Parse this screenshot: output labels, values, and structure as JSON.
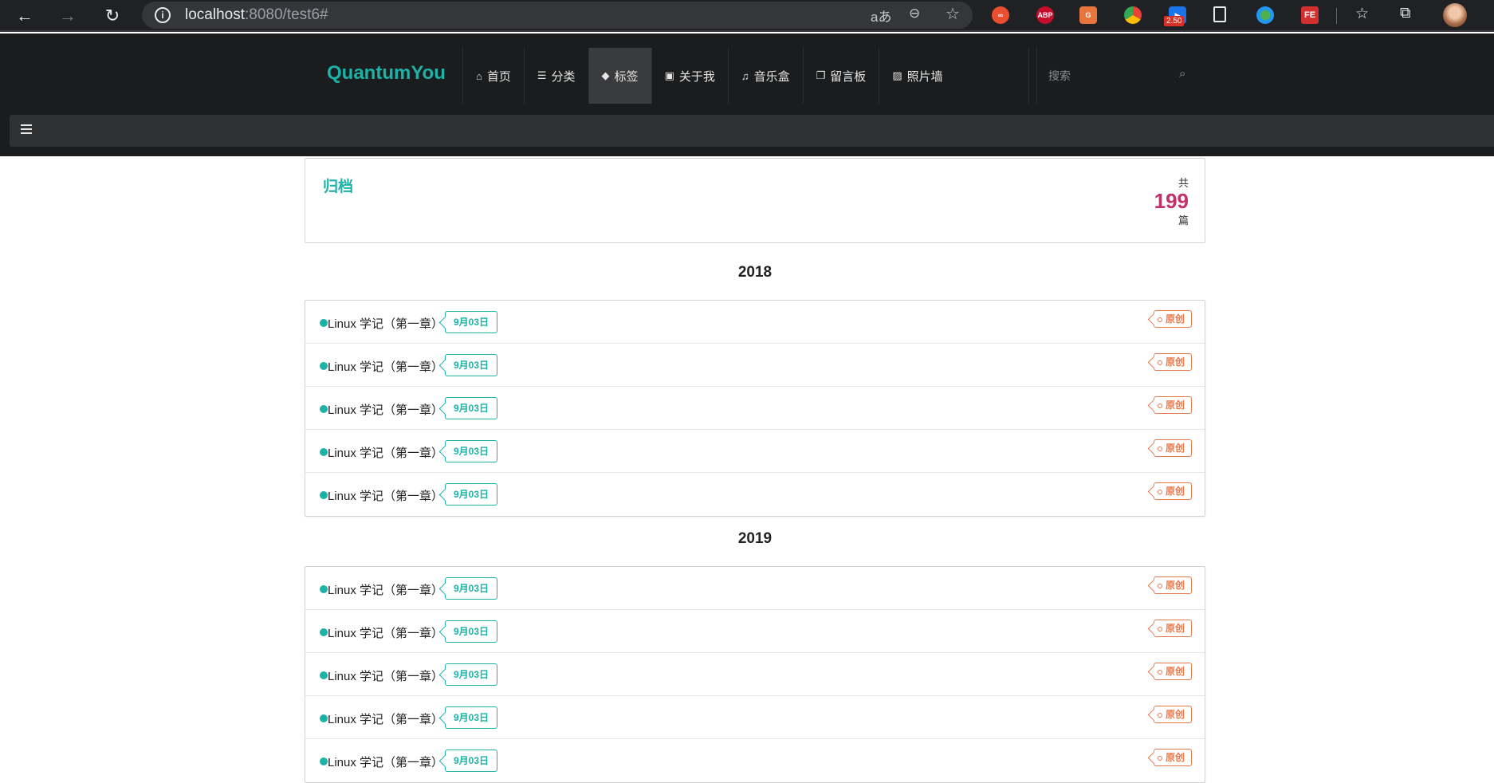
{
  "browser": {
    "url_host": "localhost",
    "url_rest": ":8080/test6#",
    "translate_icon": "aあ",
    "ext_abp": "ABP",
    "ext_go": "G",
    "ext_badge": "2.50",
    "ext_fe": "FE"
  },
  "site": {
    "brand": "QuantumYou",
    "menu": [
      {
        "icon": "⌂",
        "label": "首页"
      },
      {
        "icon": "☰",
        "label": "分类"
      },
      {
        "icon": "◆",
        "label": "标签"
      },
      {
        "icon": "▣",
        "label": "关于我"
      },
      {
        "icon": "♫",
        "label": "音乐盒"
      },
      {
        "icon": "❐",
        "label": "留言板"
      },
      {
        "icon": "▨",
        "label": "照片墙"
      }
    ],
    "search_placeholder": "搜索"
  },
  "archive": {
    "title": "归档",
    "count_pre": "共",
    "count": "199",
    "count_post": "篇"
  },
  "groups": [
    {
      "year": "2018",
      "items": [
        {
          "title": "Linux 学记（第一章）",
          "date": "9月03日",
          "tag": "原创"
        },
        {
          "title": "Linux 学记（第一章）",
          "date": "9月03日",
          "tag": "原创"
        },
        {
          "title": "Linux 学记（第一章）",
          "date": "9月03日",
          "tag": "原创"
        },
        {
          "title": "Linux 学记（第一章）",
          "date": "9月03日",
          "tag": "原创"
        },
        {
          "title": "Linux 学记（第一章）",
          "date": "9月03日",
          "tag": "原创"
        }
      ]
    },
    {
      "year": "2019",
      "items": [
        {
          "title": "Linux 学记（第一章）",
          "date": "9月03日",
          "tag": "原创"
        },
        {
          "title": "Linux 学记（第一章）",
          "date": "9月03日",
          "tag": "原创"
        },
        {
          "title": "Linux 学记（第一章）",
          "date": "9月03日",
          "tag": "原创"
        },
        {
          "title": "Linux 学记（第一章）",
          "date": "9月03日",
          "tag": "原创"
        },
        {
          "title": "Linux 学记（第一章）",
          "date": "9月03日",
          "tag": "原创"
        }
      ]
    }
  ],
  "colors": {
    "accent": "#1cb2a8",
    "count": "#c2306e",
    "tag": "#e8794b",
    "header_bg": "#1b1c1d"
  }
}
